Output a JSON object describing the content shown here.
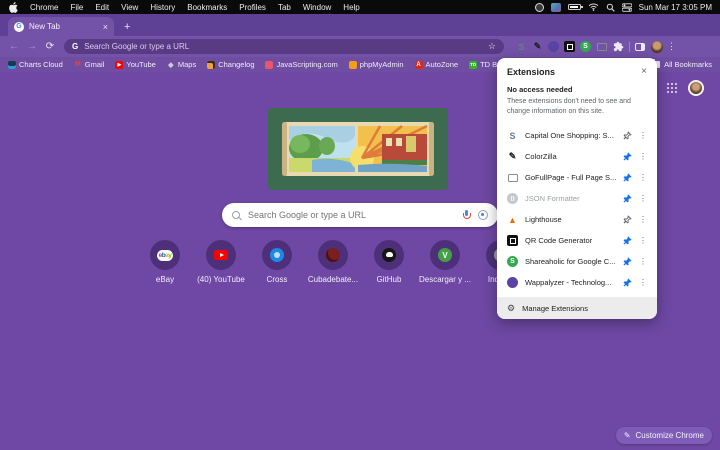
{
  "menubar": {
    "items": [
      "Chrome",
      "File",
      "Edit",
      "View",
      "History",
      "Bookmarks",
      "Profiles",
      "Tab",
      "Window",
      "Help"
    ],
    "clock": "Sun Mar 17 3:05 PM"
  },
  "tabstrip": {
    "tab_title": "New Tab",
    "favicon_letter": "G",
    "close_glyph": "×",
    "new_tab_glyph": "+"
  },
  "toolbar": {
    "back_glyph": "←",
    "forward_glyph": "→",
    "reload_glyph": "⟳",
    "omnibox_g": "G",
    "omnibox_placeholder": "Search Google or type a URL",
    "star_glyph": "☆",
    "menu_glyph": "⋮",
    "extension_icons": [
      {
        "icon": "capital-one",
        "glyph": "S"
      },
      {
        "icon": "colorzilla",
        "glyph": "✎"
      },
      {
        "icon": "wappalyzer",
        "glyph": ""
      },
      {
        "icon": "qr-code",
        "glyph": ""
      },
      {
        "icon": "shareaholic",
        "glyph": "S"
      },
      {
        "icon": "gofullpage",
        "glyph": ""
      }
    ]
  },
  "bookmarks": {
    "items": [
      {
        "label": "Charts Cloud",
        "icon": "charts-cloud",
        "glyph": ""
      },
      {
        "label": "Gmail",
        "icon": "gmail",
        "glyph": "M"
      },
      {
        "label": "YouTube",
        "icon": "youtube",
        "glyph": "▶"
      },
      {
        "label": "Maps",
        "icon": "maps",
        "glyph": "◆"
      },
      {
        "label": "Changelog",
        "icon": "changelog",
        "glyph": ""
      },
      {
        "label": "JavaScripting.com",
        "icon": "javascripting",
        "glyph": ""
      },
      {
        "label": "phpMyAdmin",
        "icon": "phpmyadmin",
        "glyph": ""
      },
      {
        "label": "AutoZone",
        "icon": "autozone",
        "glyph": "A"
      },
      {
        "label": "TD Bank",
        "icon": "td-bank",
        "glyph": "TD"
      }
    ],
    "all_bookmarks_label": "All Bookmarks"
  },
  "page": {
    "search_placeholder": "Search Google or type a URL",
    "customize_label": "Customize Chrome",
    "customize_glyph": "✎",
    "flask_glyph": "⚗",
    "shortcuts": [
      {
        "label": "eBay",
        "icon": "ebay"
      },
      {
        "label": "(40) YouTube",
        "icon": "youtube-play"
      },
      {
        "label": "Cross",
        "icon": "cross"
      },
      {
        "label": "Cubadebate...",
        "icon": "cubadebate"
      },
      {
        "label": "GitHub",
        "icon": "github"
      },
      {
        "label": "Descargar y ...",
        "icon": "descargar",
        "glyph": "V"
      },
      {
        "label": "Index...",
        "icon": "index"
      }
    ]
  },
  "extensions_panel": {
    "title": "Extensions",
    "close_glyph": "×",
    "section_title": "No access needed",
    "section_desc": "These extensions don't need to see and change information on this site.",
    "items": [
      {
        "name": "Capital One Shopping: S...",
        "icon": "capital-one",
        "glyph": "S",
        "pinned": false,
        "disabled": false
      },
      {
        "name": "ColorZilla",
        "icon": "colorzilla",
        "glyph": "✎",
        "pinned": true,
        "disabled": false
      },
      {
        "name": "GoFullPage - Full Page S...",
        "icon": "gofullpage",
        "glyph": "",
        "pinned": true,
        "disabled": false
      },
      {
        "name": "JSON Formatter",
        "icon": "json-formatter",
        "glyph": "{}",
        "pinned": true,
        "disabled": true
      },
      {
        "name": "Lighthouse",
        "icon": "lighthouse",
        "glyph": "▲",
        "pinned": false,
        "disabled": false
      },
      {
        "name": "QR Code Generator",
        "icon": "qr-code",
        "glyph": "",
        "pinned": true,
        "disabled": false
      },
      {
        "name": "Shareaholic for Google C...",
        "icon": "shareaholic",
        "glyph": "S",
        "pinned": true,
        "disabled": false
      },
      {
        "name": "Wappalyzer - Technolog...",
        "icon": "wappalyzer",
        "glyph": "",
        "pinned": true,
        "disabled": false
      }
    ],
    "footer_label": "Manage Extensions",
    "gear_glyph": "⚙",
    "menu_glyph": "⋮",
    "pin_color": "#1a73e8"
  },
  "colors": {
    "frame": "#5e4094",
    "toolbar": "#7353a7",
    "omnibox": "#583a85",
    "bookmarks_bar": "#6f4ea2",
    "page_bg": "#6e48a4",
    "doodle_card": "#3c6b4f",
    "panel_bg": "#ffffff",
    "accent_pin": "#1a73e8"
  }
}
